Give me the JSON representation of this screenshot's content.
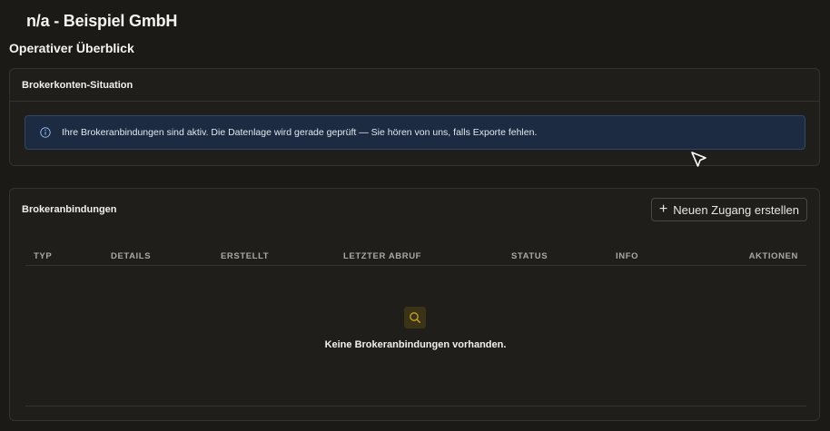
{
  "header": {
    "company": "n/a - Beispiel GmbH",
    "section_title": "Operativer Überblick"
  },
  "situation_card": {
    "title": "Brokerkonten-Situation",
    "alert_text": "Ihre Brokeranbindungen sind aktiv. Die Datenlage wird gerade geprüft — Sie hören von uns, falls Exporte fehlen."
  },
  "connections_card": {
    "title": "Brokeranbindungen",
    "new_button_label": "Neuen Zugang erstellen",
    "columns": {
      "typ": "TYP",
      "details": "DETAILS",
      "erstellt": "ERSTELLT",
      "letzter_abruf": "LETZTER ABRUF",
      "status": "STATUS",
      "info": "INFO",
      "aktionen": "AKTIONEN"
    },
    "empty_text": "Keine Brokeranbindungen vorhanden."
  },
  "colors": {
    "background": "#1b1a17",
    "card": "#1f1e1b",
    "alert_bg": "#1c2b41",
    "empty_icon_bg": "#3a3318",
    "empty_icon_fg": "#c9a22a"
  },
  "icons": {
    "alert": "info-icon",
    "empty": "search-icon",
    "button": "plus-icon",
    "pointer": "cursor-icon"
  }
}
